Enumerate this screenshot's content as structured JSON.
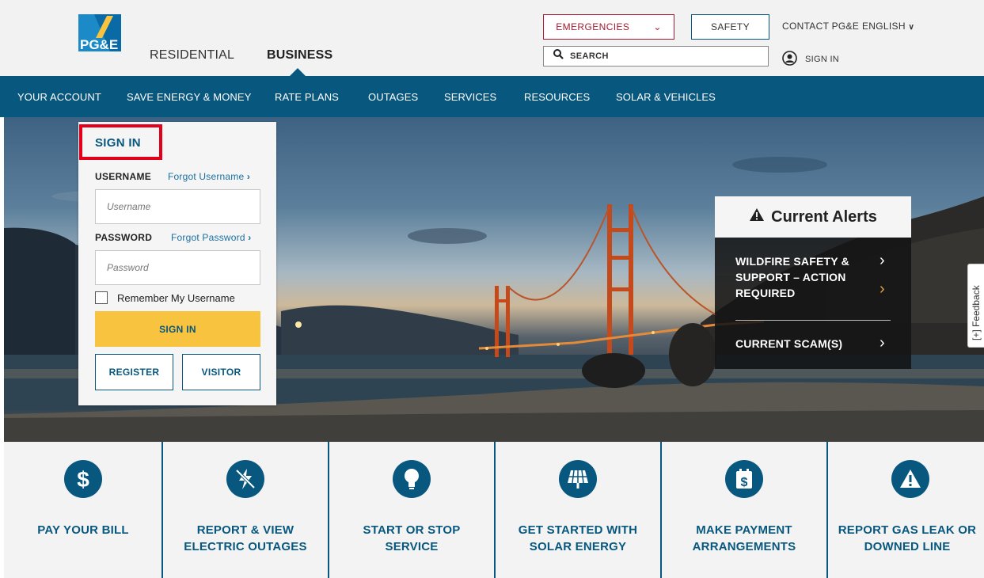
{
  "header": {
    "brand": "PG&E",
    "segments": [
      {
        "label": "RESIDENTIAL"
      },
      {
        "label": "BUSINESS"
      }
    ],
    "emergencies_label": "EMERGENCIES",
    "safety_label": "SAFETY",
    "contact_label": "CONTACT PG&E",
    "language_label": "ENGLISH",
    "search_placeholder": "SEARCH",
    "sign_in_label": "SIGN IN"
  },
  "nav": {
    "items": [
      {
        "label": "YOUR ACCOUNT"
      },
      {
        "label": "SAVE ENERGY & MONEY"
      },
      {
        "label": "RATE PLANS"
      },
      {
        "label": "OUTAGES"
      },
      {
        "label": "SERVICES"
      },
      {
        "label": "RESOURCES"
      },
      {
        "label": "SOLAR & VEHICLES"
      }
    ]
  },
  "signin": {
    "title": "SIGN IN",
    "username_label": "USERNAME",
    "forgot_username": "Forgot Username",
    "username_placeholder": "Username",
    "password_label": "PASSWORD",
    "forgot_password": "Forgot Password",
    "password_placeholder": "Password",
    "remember_label": "Remember My Username",
    "remember_checked": false,
    "submit_label": "SIGN IN",
    "register_label": "REGISTER",
    "visitor_label": "VISITOR"
  },
  "alerts": {
    "title": "Current Alerts",
    "items": [
      {
        "line1": "WILDFIRE SAFETY &",
        "line2": "SUPPORT – ACTION",
        "line3": "REQUIRED"
      },
      {
        "line1": "CURRENT SCAM(S)"
      }
    ]
  },
  "feedback": {
    "label": "[+] Feedback"
  },
  "quick_links": [
    {
      "icon": "dollar-icon",
      "line1": "PAY YOUR BILL",
      "line2": ""
    },
    {
      "icon": "lightning-off-icon",
      "line1": "REPORT & VIEW",
      "line2": "ELECTRIC OUTAGES"
    },
    {
      "icon": "lightbulb-icon",
      "line1": "START OR STOP",
      "line2": "SERVICE"
    },
    {
      "icon": "solar-panel-icon",
      "line1": "GET STARTED WITH",
      "line2": "SOLAR ENERGY"
    },
    {
      "icon": "calendar-dollar-icon",
      "line1": "MAKE PAYMENT",
      "line2": "ARRANGEMENTS"
    },
    {
      "icon": "warning-icon",
      "line1": "REPORT GAS LEAK OR",
      "line2": "DOWNED LINE"
    }
  ],
  "colors": {
    "brand_blue": "#07577e",
    "accent_yellow": "#f8c33f",
    "emergency_red": "#a6192e",
    "highlight_red": "#e2001a"
  }
}
